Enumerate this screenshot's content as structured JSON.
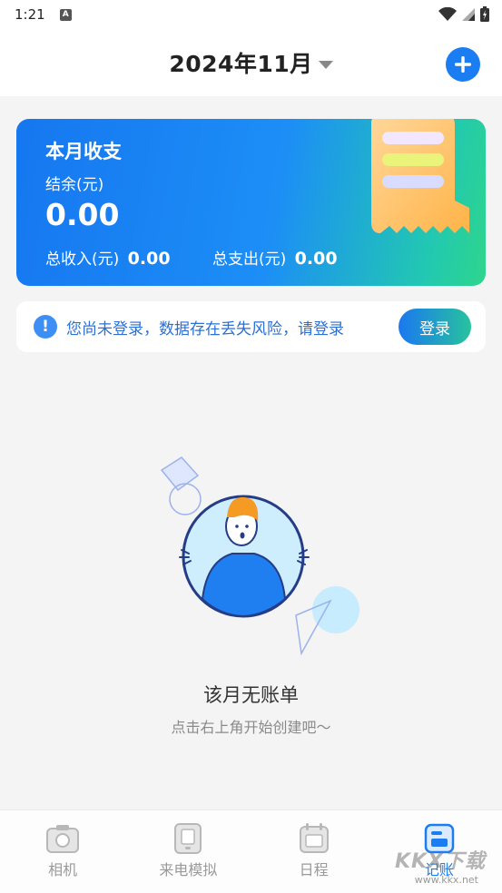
{
  "status_bar": {
    "time": "1:21",
    "notification_icon": "A"
  },
  "header": {
    "month": "2024年11月"
  },
  "summary": {
    "title": "本月收支",
    "balance_label": "结余(元)",
    "balance_value": "0.00",
    "income_label": "总收入(元)",
    "income_value": "0.00",
    "expense_label": "总支出(元)",
    "expense_value": "0.00"
  },
  "login_notice": {
    "icon": "!",
    "text": "您尚未登录，数据存在丢失风险，请登录",
    "button_label": "登录"
  },
  "empty_state": {
    "title": "该月无账单",
    "subtitle": "点击右上角开始创建吧～"
  },
  "bottom_nav": [
    {
      "label": "相机",
      "icon": "camera-icon"
    },
    {
      "label": "来电模拟",
      "icon": "phone-icon"
    },
    {
      "label": "日程",
      "icon": "calendar-icon"
    },
    {
      "label": "记账",
      "icon": "ledger-icon",
      "active": true
    }
  ],
  "watermark": {
    "brand": "KKX下载",
    "url": "www.kkx.net"
  },
  "colors": {
    "accent": "#1a7ef2",
    "card_start": "#1677f0",
    "card_end": "#2ed58c",
    "background": "#f4f4f5"
  }
}
